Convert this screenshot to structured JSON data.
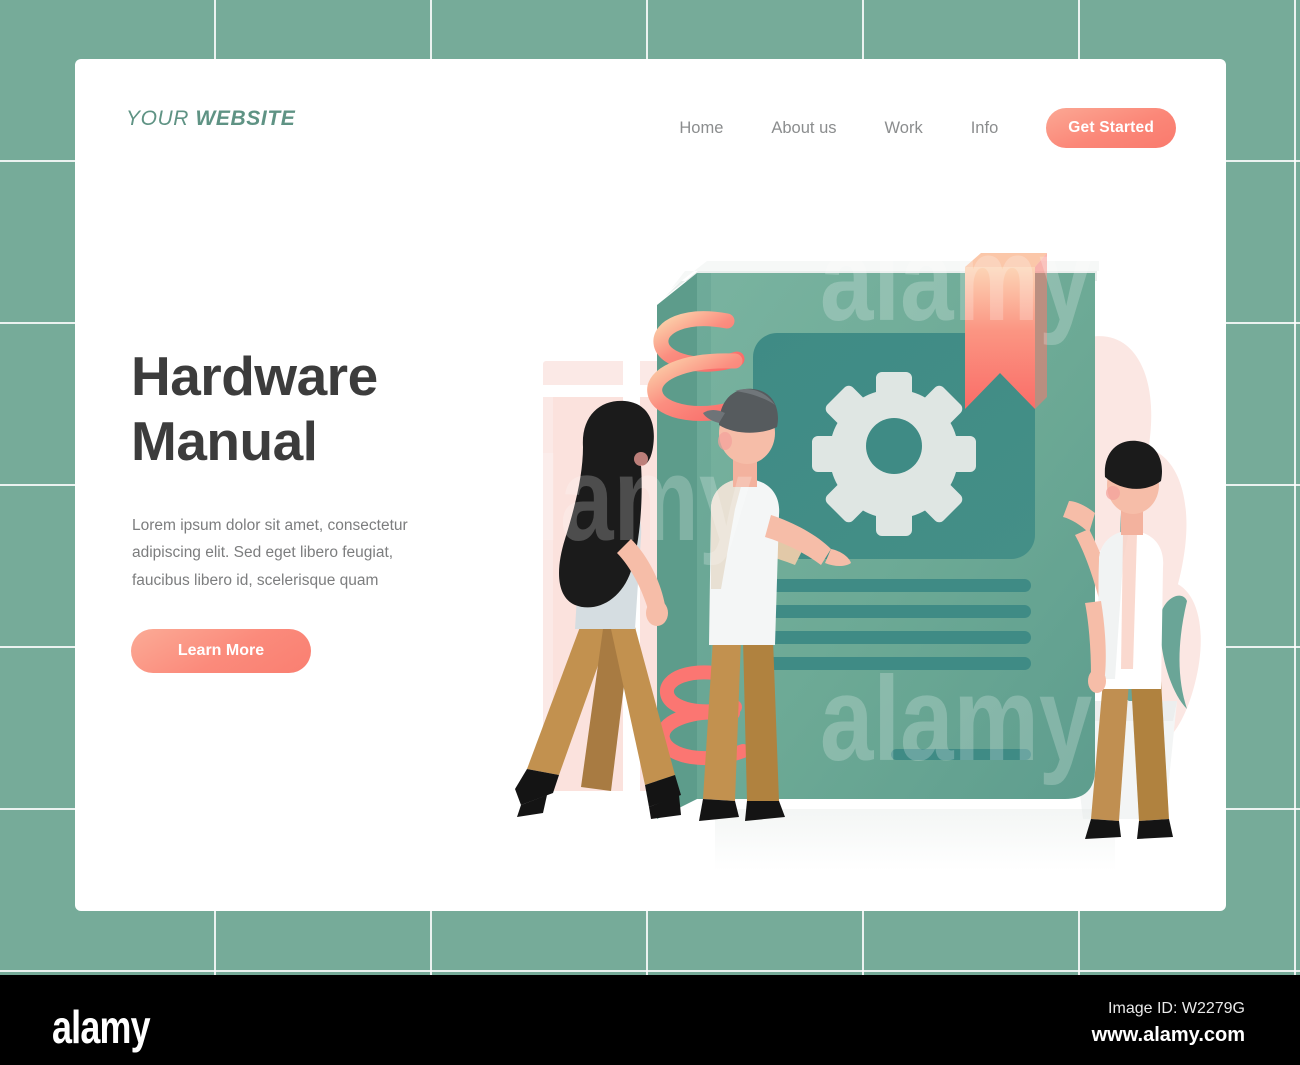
{
  "brand": {
    "logo_light": "YOUR",
    "logo_bold": "WEBSITE",
    "logo_color": "#5f9384"
  },
  "nav": {
    "links": [
      {
        "label": "Home"
      },
      {
        "label": "About us"
      },
      {
        "label": "Work"
      },
      {
        "label": "Info"
      }
    ],
    "cta_label": "Get Started",
    "cta_color": "#fb8778"
  },
  "hero": {
    "headline": "Hardware\nManual",
    "headline_color": "#3c3c3c",
    "paragraph": "Lorem ipsum dolor sit amet, consectetur adipiscing elit. Sed eget libero feugiat, faucibus libero id, scelerisque quam",
    "button_label": "Learn More",
    "button_color": "#fb8a7b"
  },
  "illustration": {
    "subject": "hardware-manual-book",
    "book_cover_color": "#6faa96",
    "book_panel_color": "#3f8a84",
    "gear_icon_color": "#dfe6e3",
    "bookmark_color": "#fb7d72",
    "spiral_color": "#fb6f6b",
    "plant_leaf_color": "#4e9183",
    "icons": [
      "gear-icon",
      "bookmark-ribbon-icon",
      "spiral-decoration-icon",
      "potted-plant-icon"
    ],
    "people": [
      {
        "name": "woman-walking",
        "hair": "#1b1b1b",
        "top": "#d5dde1",
        "pants": "#c2914f",
        "shoes": "#141414"
      },
      {
        "name": "man-with-cap",
        "hair": "#565b5e",
        "top": "#f3f5f6",
        "pants": "#c2914f",
        "shoes": "#141414"
      },
      {
        "name": "person-reaching",
        "hair": "#1b1b1b",
        "top": "#ffffff",
        "pants": "#c08f51",
        "shoes": "#141414"
      }
    ],
    "book_text_lines": 4
  },
  "background": {
    "tile_color": "#76ab99",
    "grid_line_color": "#ffffff",
    "card_color": "#ffffff"
  },
  "stock_chrome": {
    "wordmark": "alamy",
    "image_id": "Image ID: W2279G",
    "url": "www.alamy.com",
    "watermark_text": "alamy"
  }
}
